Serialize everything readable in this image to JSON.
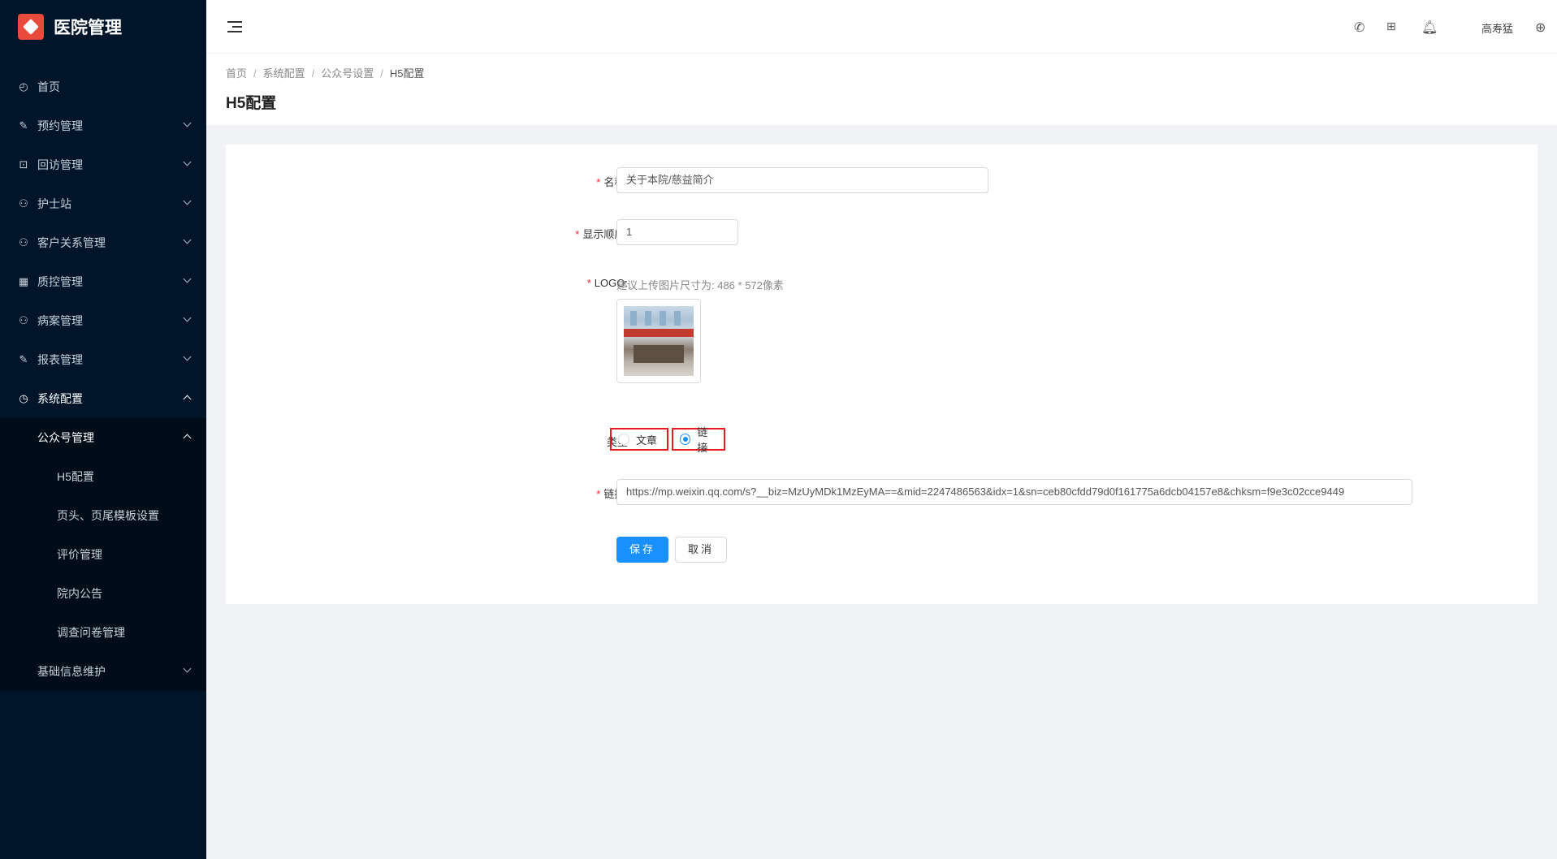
{
  "app": {
    "title": "医院管理",
    "logo_icon": "hospital-logo-icon"
  },
  "sidebar": {
    "items": [
      {
        "label": "首页",
        "icon": "dashboard-icon"
      },
      {
        "label": "预约管理",
        "icon": "edit-icon"
      },
      {
        "label": "回访管理",
        "icon": "lock-icon"
      },
      {
        "label": "护士站",
        "icon": "user-icon"
      },
      {
        "label": "客户关系管理",
        "icon": "user-icon"
      },
      {
        "label": "质控管理",
        "icon": "table-icon"
      },
      {
        "label": "病案管理",
        "icon": "user-icon"
      },
      {
        "label": "报表管理",
        "icon": "edit-icon"
      },
      {
        "label": "系统配置",
        "icon": "settings-icon"
      }
    ],
    "sub": {
      "group": "公众号管理",
      "children": [
        "H5配置",
        "页头、页尾模板设置",
        "评价管理",
        "院内公告",
        "调查问卷管理"
      ],
      "other": "基础信息维护"
    }
  },
  "header": {
    "user": "高寿猛",
    "icons": [
      "phone-icon",
      "grid-icon",
      "bell-icon",
      "globe-icon"
    ]
  },
  "breadcrumb": [
    "首页",
    "系统配置",
    "公众号设置",
    "H5配置"
  ],
  "page_title": "H5配置",
  "form": {
    "name_label": "名称",
    "name_value": "关于本院/慈益简介",
    "order_label": "显示顺序",
    "order_value": "1",
    "logo_label": "LOGO",
    "logo_hint": "建议上传图片尺寸为: 486 * 572像素",
    "type_label": "类型",
    "type_options": [
      "文章",
      "链接"
    ],
    "type_selected": "链接",
    "link_label": "链接",
    "link_value": "https://mp.weixin.qq.com/s?__biz=MzUyMDk1MzEyMA==&mid=2247486563&idx=1&sn=ceb80cfdd79d0f161775a6dcb04157e8&chksm=f9e3c02cce9449",
    "save": "保存",
    "cancel": "取消"
  },
  "colors": {
    "sidebar_bg": "#001529",
    "primary": "#1890ff",
    "required": "#f5222d",
    "highlight_border": "#e8191c"
  }
}
